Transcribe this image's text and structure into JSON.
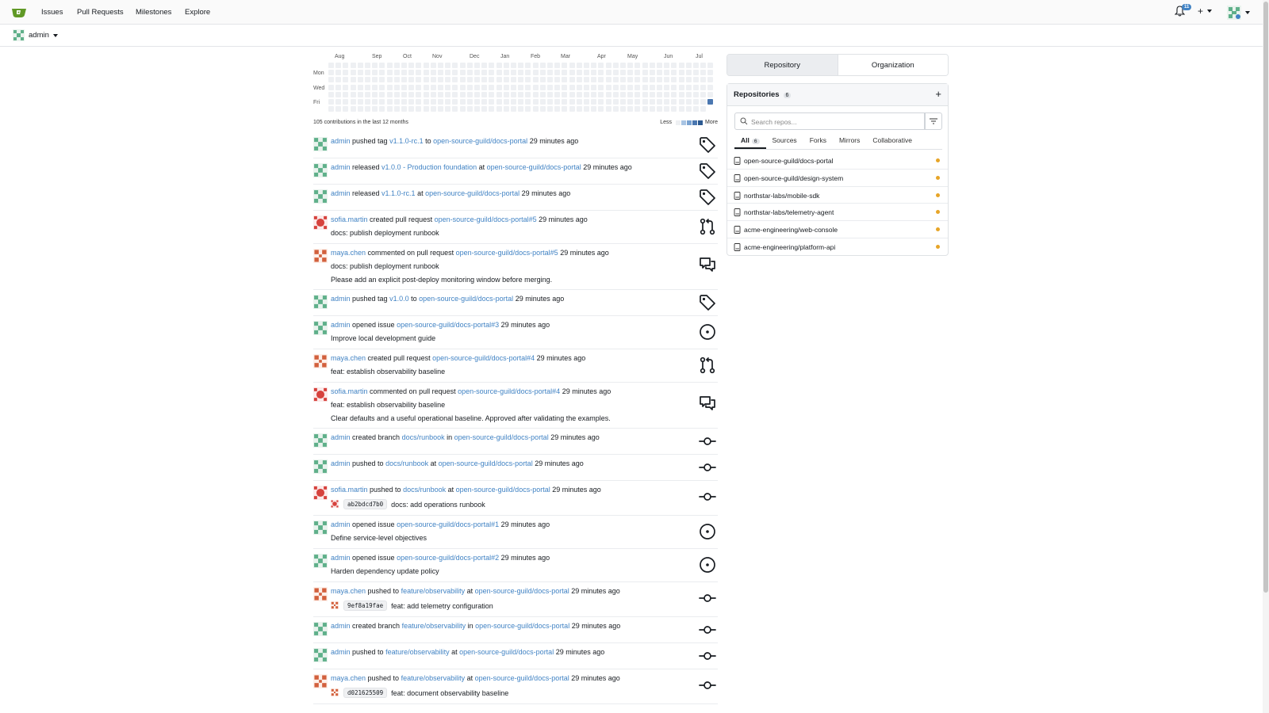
{
  "nav": {
    "items": [
      "Issues",
      "Pull Requests",
      "Milestones",
      "Explore"
    ],
    "notifications_count": "11"
  },
  "context": {
    "user": "admin"
  },
  "heatmap": {
    "months": [
      "Aug",
      "Sep",
      "Oct",
      "Nov",
      "Dec",
      "Jan",
      "Feb",
      "Mar",
      "Apr",
      "May",
      "Jun",
      "Jul"
    ],
    "days": [
      "Mon",
      "Wed",
      "Fri"
    ],
    "summary": "105 contributions in the last 12 months",
    "legend_less": "Less",
    "legend_more": "More",
    "colors": [
      "#eef0f3",
      "#a8c4e3",
      "#7aa3d1",
      "#4a77b0",
      "#2d5a91"
    ],
    "active_cell_color": "#4a77b0"
  },
  "feed": [
    {
      "user": "admin",
      "avatar": "green",
      "parts": [
        [
          "t",
          " pushed tag "
        ],
        [
          "l",
          "v1.1.0-rc.1"
        ],
        [
          "t",
          " to "
        ],
        [
          "l",
          "open-source-guild/docs-portal"
        ],
        [
          "t",
          " 29 minutes ago"
        ]
      ],
      "icon": "tag-icon"
    },
    {
      "user": "admin",
      "avatar": "green",
      "parts": [
        [
          "t",
          " released "
        ],
        [
          "l",
          "v1.0.0 - Production foundation"
        ],
        [
          "t",
          " at "
        ],
        [
          "l",
          "open-source-guild/docs-portal"
        ],
        [
          "t",
          " 29 minutes ago"
        ]
      ],
      "icon": "tag-icon"
    },
    {
      "user": "admin",
      "avatar": "green",
      "parts": [
        [
          "t",
          " released "
        ],
        [
          "l",
          "v1.1.0-rc.1"
        ],
        [
          "t",
          " at "
        ],
        [
          "l",
          "open-source-guild/docs-portal"
        ],
        [
          "t",
          " 29 minutes ago"
        ]
      ],
      "icon": "tag-icon"
    },
    {
      "user": "sofia.martin",
      "avatar": "red",
      "parts": [
        [
          "t",
          " created pull request "
        ],
        [
          "l",
          "open-source-guild/docs-portal#5"
        ],
        [
          "t",
          " 29 minutes ago"
        ]
      ],
      "line2": "docs: publish deployment runbook",
      "icon": "pull-request-icon"
    },
    {
      "user": "maya.chen",
      "avatar": "orange",
      "parts": [
        [
          "t",
          " commented on pull request "
        ],
        [
          "l",
          "open-source-guild/docs-portal#5"
        ],
        [
          "t",
          " 29 minutes ago"
        ]
      ],
      "line2_link": "docs: publish deployment runbook",
      "line3": "Please add an explicit post-deploy monitoring window before merging.",
      "icon": "comment-icon"
    },
    {
      "user": "admin",
      "avatar": "green",
      "parts": [
        [
          "t",
          " pushed tag "
        ],
        [
          "l",
          "v1.0.0"
        ],
        [
          "t",
          " to "
        ],
        [
          "l",
          "open-source-guild/docs-portal"
        ],
        [
          "t",
          " 29 minutes ago"
        ]
      ],
      "icon": "tag-icon"
    },
    {
      "user": "admin",
      "avatar": "green",
      "parts": [
        [
          "t",
          " opened issue "
        ],
        [
          "l",
          "open-source-guild/docs-portal#3"
        ],
        [
          "t",
          " 29 minutes ago"
        ]
      ],
      "line2": "Improve local development guide",
      "icon": "issue-icon"
    },
    {
      "user": "maya.chen",
      "avatar": "orange",
      "parts": [
        [
          "t",
          " created pull request "
        ],
        [
          "l",
          "open-source-guild/docs-portal#4"
        ],
        [
          "t",
          " 29 minutes ago"
        ]
      ],
      "line2": "feat: establish observability baseline",
      "icon": "pull-request-icon"
    },
    {
      "user": "sofia.martin",
      "avatar": "red",
      "parts": [
        [
          "t",
          " commented on pull request "
        ],
        [
          "l",
          "open-source-guild/docs-portal#4"
        ],
        [
          "t",
          " 29 minutes ago"
        ]
      ],
      "line2_link": "feat: establish observability baseline",
      "line3": "Clear defaults and a useful operational baseline. Approved after validating the examples.",
      "icon": "comment-icon"
    },
    {
      "user": "admin",
      "avatar": "green",
      "parts": [
        [
          "t",
          " created branch "
        ],
        [
          "l",
          "docs/runbook"
        ],
        [
          "t",
          " in "
        ],
        [
          "l",
          "open-source-guild/docs-portal"
        ],
        [
          "t",
          " 29 minutes ago"
        ]
      ],
      "icon": "commit-icon"
    },
    {
      "user": "admin",
      "avatar": "green",
      "parts": [
        [
          "t",
          " pushed to "
        ],
        [
          "l",
          "docs/runbook"
        ],
        [
          "t",
          " at "
        ],
        [
          "l",
          "open-source-guild/docs-portal"
        ],
        [
          "t",
          " 29 minutes ago"
        ]
      ],
      "icon": "commit-icon"
    },
    {
      "user": "sofia.martin",
      "avatar": "red",
      "parts": [
        [
          "t",
          " pushed to "
        ],
        [
          "l",
          "docs/runbook"
        ],
        [
          "t",
          " at "
        ],
        [
          "l",
          "open-source-guild/docs-portal"
        ],
        [
          "t",
          " 29 minutes ago"
        ]
      ],
      "commit": {
        "sha": "ab2bdcd7b0",
        "msg": "docs: add operations runbook",
        "avatar": "red"
      },
      "icon": "commit-icon"
    },
    {
      "user": "admin",
      "avatar": "green",
      "parts": [
        [
          "t",
          " opened issue "
        ],
        [
          "l",
          "open-source-guild/docs-portal#1"
        ],
        [
          "t",
          " 29 minutes ago"
        ]
      ],
      "line2": "Define service-level objectives",
      "icon": "issue-icon"
    },
    {
      "user": "admin",
      "avatar": "green",
      "parts": [
        [
          "t",
          " opened issue "
        ],
        [
          "l",
          "open-source-guild/docs-portal#2"
        ],
        [
          "t",
          " 29 minutes ago"
        ]
      ],
      "line2": "Harden dependency update policy",
      "icon": "issue-icon"
    },
    {
      "user": "maya.chen",
      "avatar": "orange",
      "parts": [
        [
          "t",
          " pushed to "
        ],
        [
          "l",
          "feature/observability"
        ],
        [
          "t",
          " at "
        ],
        [
          "l",
          "open-source-guild/docs-portal"
        ],
        [
          "t",
          " 29 minutes ago"
        ]
      ],
      "commit": {
        "sha": "9ef8a19fae",
        "msg": "feat: add telemetry configuration",
        "avatar": "orange"
      },
      "icon": "commit-icon"
    },
    {
      "user": "admin",
      "avatar": "green",
      "parts": [
        [
          "t",
          " created branch "
        ],
        [
          "l",
          "feature/observability"
        ],
        [
          "t",
          " in "
        ],
        [
          "l",
          "open-source-guild/docs-portal"
        ],
        [
          "t",
          " 29 minutes ago"
        ]
      ],
      "icon": "commit-icon"
    },
    {
      "user": "admin",
      "avatar": "green",
      "parts": [
        [
          "t",
          " pushed to "
        ],
        [
          "l",
          "feature/observability"
        ],
        [
          "t",
          " at "
        ],
        [
          "l",
          "open-source-guild/docs-portal"
        ],
        [
          "t",
          " 29 minutes ago"
        ]
      ],
      "icon": "commit-icon"
    },
    {
      "user": "maya.chen",
      "avatar": "orange",
      "parts": [
        [
          "t",
          " pushed to "
        ],
        [
          "l",
          "feature/observability"
        ],
        [
          "t",
          " at "
        ],
        [
          "l",
          "open-source-guild/docs-portal"
        ],
        [
          "t",
          " 29 minutes ago"
        ]
      ],
      "commit": {
        "sha": "d021625509",
        "msg": "feat: document observability baseline",
        "avatar": "orange"
      },
      "icon": "commit-icon"
    }
  ],
  "right": {
    "tab_repository": "Repository",
    "tab_organization": "Organization",
    "repos_title": "Repositories",
    "repos_count": "6",
    "search_placeholder": "Search repos...",
    "filter_tabs": [
      "All",
      "Sources",
      "Forks",
      "Mirrors",
      "Collaborative"
    ],
    "all_count": "6",
    "repos": [
      "open-source-guild/docs-portal",
      "open-source-guild/design-system",
      "northstar-labs/mobile-sdk",
      "northstar-labs/telemetry-agent",
      "acme-engineering/web-console",
      "acme-engineering/platform-api"
    ],
    "repo_dot_color": "#e7a528"
  }
}
